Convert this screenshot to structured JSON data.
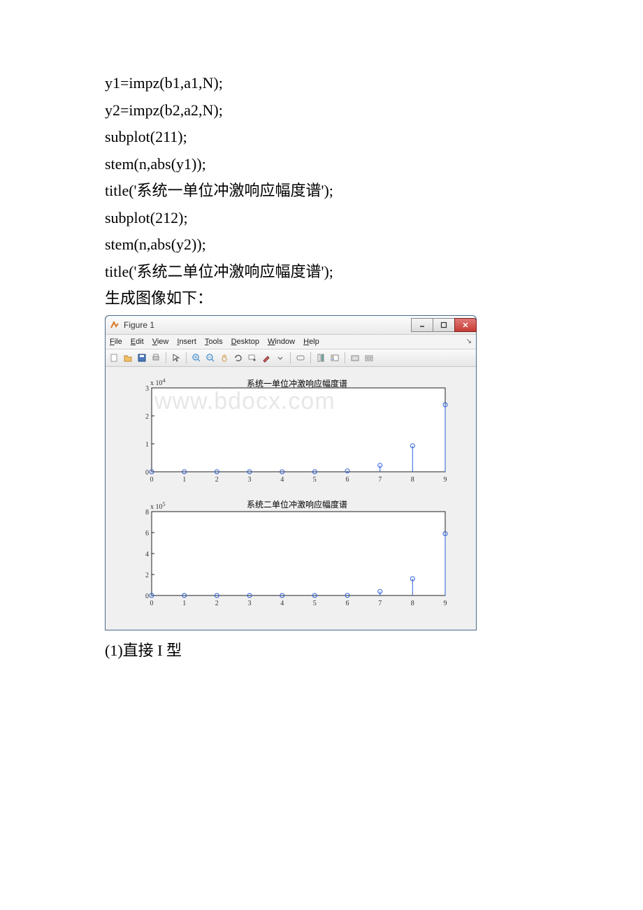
{
  "code": {
    "l1": "y1=impz(b1,a1,N);",
    "l2": "y2=impz(b2,a2,N);",
    "l3": "subplot(211);",
    "l4": "stem(n,abs(y1));",
    "l5": "title('系统一单位冲激响应幅度谱');",
    "l6": "subplot(212);",
    "l7": "stem(n,abs(y2));",
    "l8": "title('系统二单位冲激响应幅度谱');",
    "l9": "生成图像如下："
  },
  "figure": {
    "title": "Figure 1",
    "menu": [
      "File",
      "Edit",
      "View",
      "Insert",
      "Tools",
      "Desktop",
      "Window",
      "Help"
    ],
    "watermark": "www.bdocx.com"
  },
  "chart_data": [
    {
      "type": "bar",
      "title": "系统一单位冲激响应幅度谱",
      "yexp_label": "x 10",
      "yexp_sup": "4",
      "xlabel": "",
      "ylabel": "",
      "categories": [
        0,
        1,
        2,
        3,
        4,
        5,
        6,
        7,
        8,
        9
      ],
      "values": [
        0,
        0,
        0,
        0,
        0,
        0,
        300,
        2300,
        9300,
        24000
      ],
      "xlim": [
        0,
        9
      ],
      "ylim": [
        0,
        30000
      ],
      "yticks": [
        0,
        1,
        2,
        3
      ]
    },
    {
      "type": "bar",
      "title": "系统二单位冲激响应幅度谱",
      "yexp_label": "x 10",
      "yexp_sup": "5",
      "xlabel": "",
      "ylabel": "",
      "categories": [
        0,
        1,
        2,
        3,
        4,
        5,
        6,
        7,
        8,
        9
      ],
      "values": [
        500,
        0,
        0,
        0,
        0,
        0,
        1000,
        38000,
        160000,
        590000
      ],
      "xlim": [
        0,
        9
      ],
      "ylim": [
        0,
        800000
      ],
      "yticks": [
        0,
        2,
        4,
        6,
        8
      ]
    }
  ],
  "final": "(1)直接 I 型"
}
